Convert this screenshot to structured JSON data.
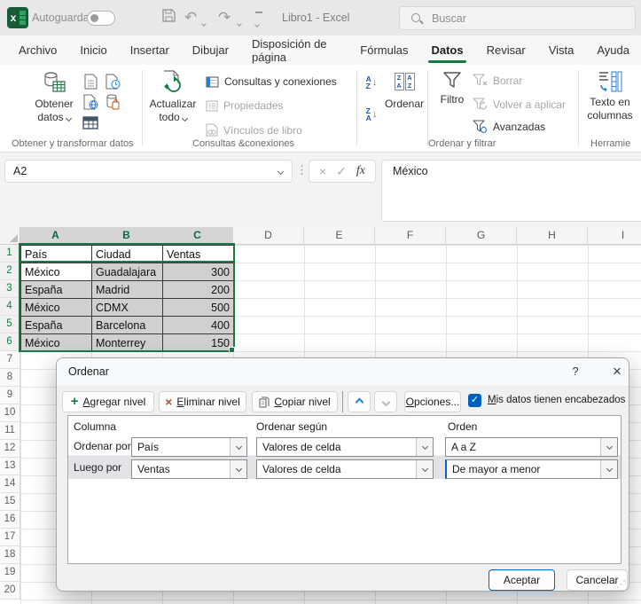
{
  "titlebar": {
    "autosave_label": "Autoguardado",
    "document_title": "Libro1  -  Excel",
    "search_placeholder": "Buscar"
  },
  "tabs": {
    "items": [
      "Archivo",
      "Inicio",
      "Insertar",
      "Dibujar",
      "Disposición de página",
      "Fórmulas",
      "Datos",
      "Revisar",
      "Vista",
      "Ayuda"
    ],
    "active": "Datos"
  },
  "ribbon": {
    "get_data": {
      "line1": "Obtener",
      "line2": "datos"
    },
    "refresh_all": {
      "line1": "Actualizar",
      "line2": "todo"
    },
    "queries_connections": "Consultas y conexiones",
    "properties": "Propiedades",
    "workbook_links": "Vínculos de libro",
    "sort_big": "Ordenar",
    "filter_big": "Filtro",
    "clear": "Borrar",
    "reapply": "Volver a aplicar",
    "advanced": "Avanzadas",
    "text_to_columns": {
      "line1": "Texto en",
      "line2": "columnas"
    },
    "groups": {
      "get_transform": "Obtener y transformar datos",
      "queries": "Consultas &conexiones",
      "sort_filter": "Ordenar y filtrar",
      "tools": "Herramie"
    }
  },
  "formula_bar": {
    "name_box": "A2",
    "value": "México",
    "fx": "fx"
  },
  "sheet": {
    "columns": [
      "A",
      "B",
      "C",
      "D",
      "E",
      "F",
      "G",
      "H",
      "I"
    ],
    "selected_columns": [
      "A",
      "B",
      "C"
    ],
    "row_count": 20,
    "selected_rows": [
      1,
      2,
      3,
      4,
      5,
      6
    ],
    "active_cell": "A2",
    "table": {
      "headers": [
        "País",
        "Ciudad",
        "Ventas"
      ],
      "rows": [
        [
          "México",
          "Guadalajara",
          "300"
        ],
        [
          "España",
          "Madrid",
          "200"
        ],
        [
          "México",
          "CDMX",
          "500"
        ],
        [
          "España",
          "Barcelona",
          "400"
        ],
        [
          "México",
          "Monterrey",
          "150"
        ]
      ]
    }
  },
  "dialog": {
    "title": "Ordenar",
    "help": "?",
    "close": "×",
    "add_level": "Agregar nivel",
    "delete_level": "Eliminar nivel",
    "copy_level": "Copiar nivel",
    "options": "Opciones...",
    "headers_checkbox": "Mis datos tienen encabezados",
    "headers_checked": true,
    "columns": [
      "Columna",
      "Ordenar según",
      "Orden"
    ],
    "levels": [
      {
        "label": "Ordenar por",
        "column": "País",
        "sort_on": "Valores de celda",
        "order": "A a Z"
      },
      {
        "label": "Luego por",
        "column": "Ventas",
        "sort_on": "Valores de celda",
        "order": "De mayor a menor"
      }
    ],
    "ok": "Aceptar",
    "cancel": "Cancelar"
  },
  "icons": {
    "undo": "↶",
    "redo": "↷",
    "more_dots": "⋮",
    "sort_arrow_down": "↓",
    "cancel_x": "×",
    "confirm_check": "✓",
    "check": "✓",
    "grip": "⋰",
    "letter_a": "A",
    "letter_z": "Z"
  },
  "colors": {
    "excel_green": "#107c41",
    "selection_border": "#1a7a44",
    "selection_fill": "#d0d0d0",
    "accent_blue": "#0067c0",
    "disabled_text": "#a6a6a6"
  }
}
